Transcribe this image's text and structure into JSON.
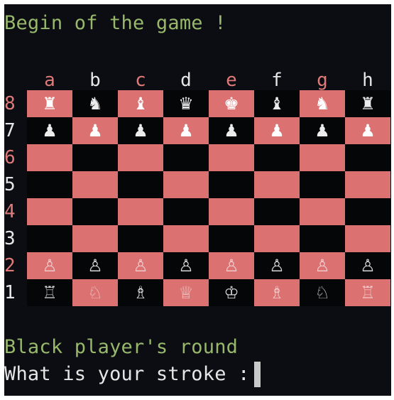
{
  "terminal": {
    "header": "Begin of the game !",
    "status": "Black player's round",
    "prompt": "What is your stroke : "
  },
  "board": {
    "files": [
      "a",
      "b",
      "c",
      "d",
      "e",
      "f",
      "g",
      "h"
    ],
    "ranks": [
      "8",
      "7",
      "6",
      "5",
      "4",
      "3",
      "2",
      "1"
    ],
    "pieces": {
      "8": [
        "♜",
        "♞",
        "♝",
        "♛",
        "♚",
        "♝",
        "♞",
        "♜"
      ],
      "7": [
        "♟",
        "♟",
        "♟",
        "♟",
        "♟",
        "♟",
        "♟",
        "♟"
      ],
      "6": [
        "",
        "",
        "",
        "",
        "",
        "",
        "",
        ""
      ],
      "5": [
        "",
        "",
        "",
        "",
        "",
        "",
        "",
        ""
      ],
      "4": [
        "",
        "",
        "",
        "",
        "",
        "",
        "",
        ""
      ],
      "3": [
        "",
        "",
        "",
        "",
        "",
        "",
        "",
        ""
      ],
      "2": [
        "♙",
        "♙",
        "♙",
        "♙",
        "♙",
        "♙",
        "♙",
        "♙"
      ],
      "1": [
        "♖",
        "♘",
        "♗",
        "♕",
        "♔",
        "♗",
        "♘",
        "♖"
      ]
    }
  },
  "colors": {
    "background": "#0b0d12",
    "light_square": "#db7171",
    "dark_square": "#050608",
    "header_text": "#98b86b",
    "label_light": "#e6e6e6",
    "label_red": "#e07a7a"
  }
}
